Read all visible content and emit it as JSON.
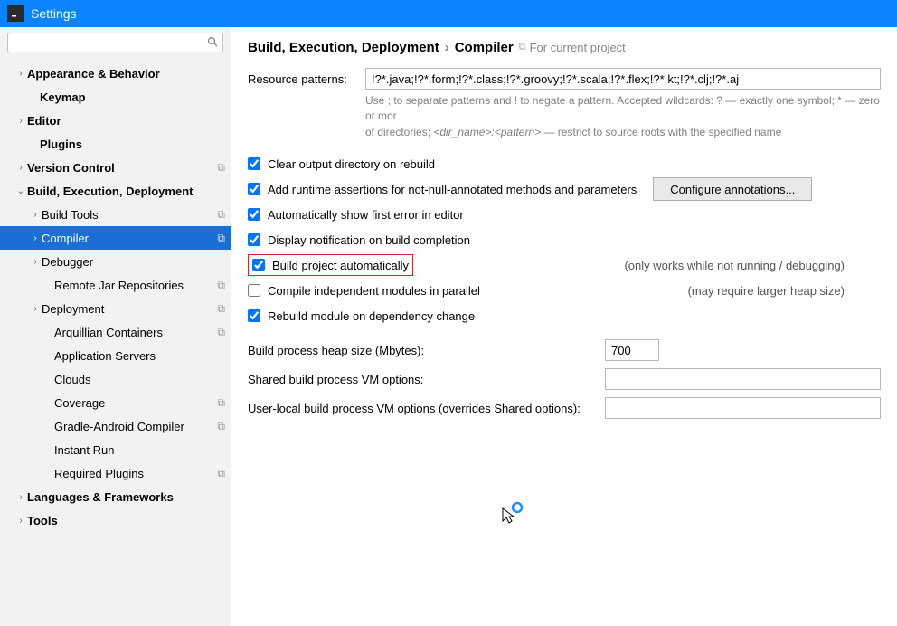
{
  "title": "Settings",
  "search_placeholder": "",
  "sidebar": {
    "items": [
      {
        "label": "Appearance & Behavior",
        "indent": 16,
        "arrow": "›",
        "bold": true
      },
      {
        "label": "Keymap",
        "indent": 30,
        "bold": true
      },
      {
        "label": "Editor",
        "indent": 16,
        "arrow": "›",
        "bold": true
      },
      {
        "label": "Plugins",
        "indent": 30,
        "bold": true
      },
      {
        "label": "Version Control",
        "indent": 16,
        "arrow": "›",
        "bold": true,
        "copy": true
      },
      {
        "label": "Build, Execution, Deployment",
        "indent": 16,
        "arrow": "⌄",
        "bold": true
      },
      {
        "label": "Build Tools",
        "indent": 32,
        "arrow": "›",
        "copy": true
      },
      {
        "label": "Compiler",
        "indent": 32,
        "arrow": "›",
        "selected": true,
        "copy": true
      },
      {
        "label": "Debugger",
        "indent": 32,
        "arrow": "›"
      },
      {
        "label": "Remote Jar Repositories",
        "indent": 46,
        "copy": true
      },
      {
        "label": "Deployment",
        "indent": 32,
        "arrow": "›",
        "copy": true
      },
      {
        "label": "Arquillian Containers",
        "indent": 46,
        "copy": true
      },
      {
        "label": "Application Servers",
        "indent": 46
      },
      {
        "label": "Clouds",
        "indent": 46
      },
      {
        "label": "Coverage",
        "indent": 46,
        "copy": true
      },
      {
        "label": "Gradle-Android Compiler",
        "indent": 46,
        "copy": true
      },
      {
        "label": "Instant Run",
        "indent": 46
      },
      {
        "label": "Required Plugins",
        "indent": 46,
        "copy": true
      },
      {
        "label": "Languages & Frameworks",
        "indent": 16,
        "arrow": "›",
        "bold": true
      },
      {
        "label": "Tools",
        "indent": 16,
        "arrow": "›",
        "bold": true
      }
    ]
  },
  "breadcrumb": {
    "a": "Build, Execution, Deployment",
    "b": "Compiler",
    "scope": "For current project"
  },
  "resource": {
    "label": "Resource patterns:",
    "value": "!?*.java;!?*.form;!?*.class;!?*.groovy;!?*.scala;!?*.flex;!?*.kt;!?*.clj;!?*.aj",
    "hint1": "Use ; to separate patterns and ! to negate a pattern. Accepted wildcards: ? — exactly one symbol; * — zero or mor",
    "hint2a": "of directories; ",
    "hint2b": "<dir_name>:<pattern>",
    "hint2c": " — restrict to source roots with the specified name"
  },
  "checks": {
    "clear": "Clear output directory on rebuild",
    "assert": "Add runtime assertions for not-null-annotated methods and parameters",
    "configure": "Configure annotations...",
    "auto_error": "Automatically show first error in editor",
    "notify": "Display notification on build completion",
    "build_auto": "Build project automatically",
    "build_auto_note": "(only works while not running / debugging)",
    "compile_ind": "Compile independent modules in parallel",
    "compile_ind_note": "(may require larger heap size)",
    "rebuild_dep": "Rebuild module on dependency change"
  },
  "fields": {
    "heap_label": "Build process heap size (Mbytes):",
    "heap_value": "700",
    "shared_label": "Shared build process VM options:",
    "shared_value": "",
    "user_label": "User-local build process VM options (overrides Shared options):",
    "user_value": ""
  }
}
